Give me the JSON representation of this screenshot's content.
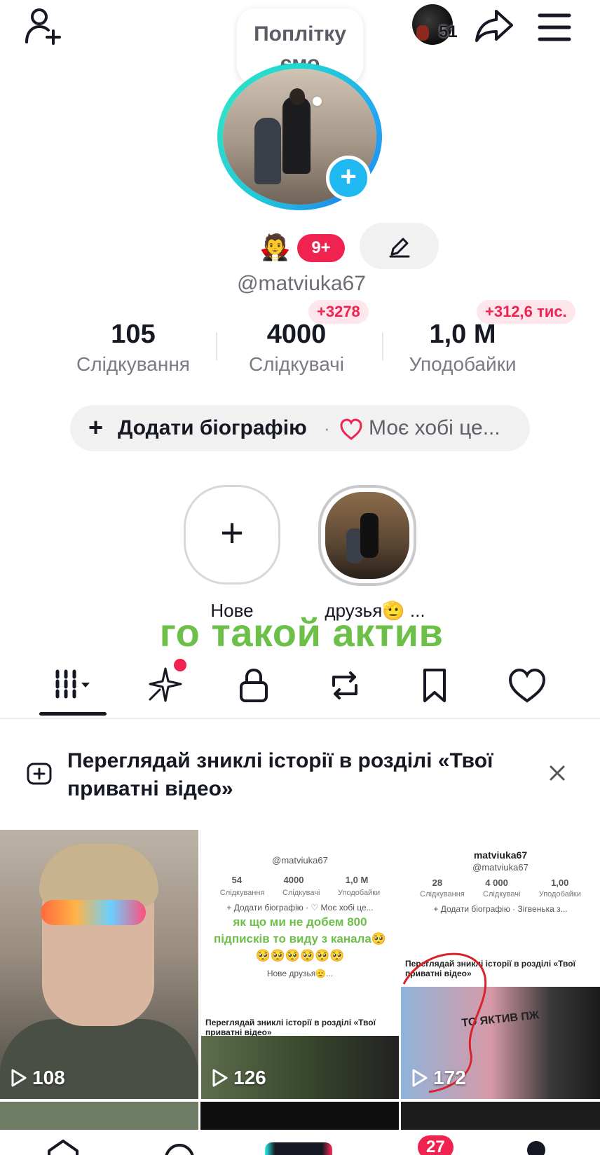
{
  "header": {
    "notification_count": "51",
    "note_text": "Поплітку ємо"
  },
  "profile": {
    "emoji": "🧛",
    "level_badge": "9+",
    "username": "@matviuka67"
  },
  "stats": [
    {
      "value": "105",
      "label": "Слідкування",
      "delta": ""
    },
    {
      "value": "4000",
      "label": "Слідкувачі",
      "delta": "+3278"
    },
    {
      "value": "1,0 M",
      "label": "Уподобайки",
      "delta": "+312,6 тис."
    }
  ],
  "bio": {
    "add_label": "Додати біографію",
    "separator": "·",
    "hobby_label": "Моє хобі це..."
  },
  "highlights": [
    {
      "label": "Нове"
    },
    {
      "label": "друзья🫡 ..."
    }
  ],
  "overlay_text": "го такой актив",
  "tabs": [
    {
      "icon": "videos-grid-icon"
    },
    {
      "icon": "sparkle-icon"
    },
    {
      "icon": "lock-icon"
    },
    {
      "icon": "repost-icon"
    },
    {
      "icon": "bookmark-icon"
    },
    {
      "icon": "heart-icon"
    }
  ],
  "banner": {
    "text": "Переглядай зниклі історії в розділі «Твої приватні відео»"
  },
  "videos": [
    {
      "views": "108"
    },
    {
      "views": "126"
    },
    {
      "views": "172"
    }
  ],
  "thumb2": {
    "username": "@matviuka67",
    "stats": [
      "54",
      "4000",
      "1,0 M"
    ],
    "labels": [
      "Слідкування",
      "Слідкувачі",
      "Уподобайки"
    ],
    "bio": "+ Додати біографію · ♡ Моє хобі це...",
    "green_text": "як що ми не добем 800 підписків то виду з канала🥺🥺🥺🥺🥺🥺🥺",
    "highlights": "Нове   друзья🫡...",
    "banner": "Переглядай зниклі історії в розділі «Твої приватні відео»"
  },
  "thumb3": {
    "name": "matviuka67",
    "username": "@matviuka67",
    "stats": [
      "28",
      "4 000",
      "1,00"
    ],
    "labels": [
      "Слідкування",
      "Слідкувачі",
      "Уподобайки"
    ],
    "bio": "+ Додати біографію · Зігвенька з...",
    "banner": "Переглядай зниклі історії в розділі «Твої приватні відео»",
    "overlay": "ТО ЯКТИВ ПЖ"
  },
  "bottom_nav": {
    "inbox_count": "27"
  },
  "colors": {
    "accent_red": "#f0224f",
    "ring_cyan": "#1fd8d0",
    "overlay_green": "#6cc04a"
  }
}
